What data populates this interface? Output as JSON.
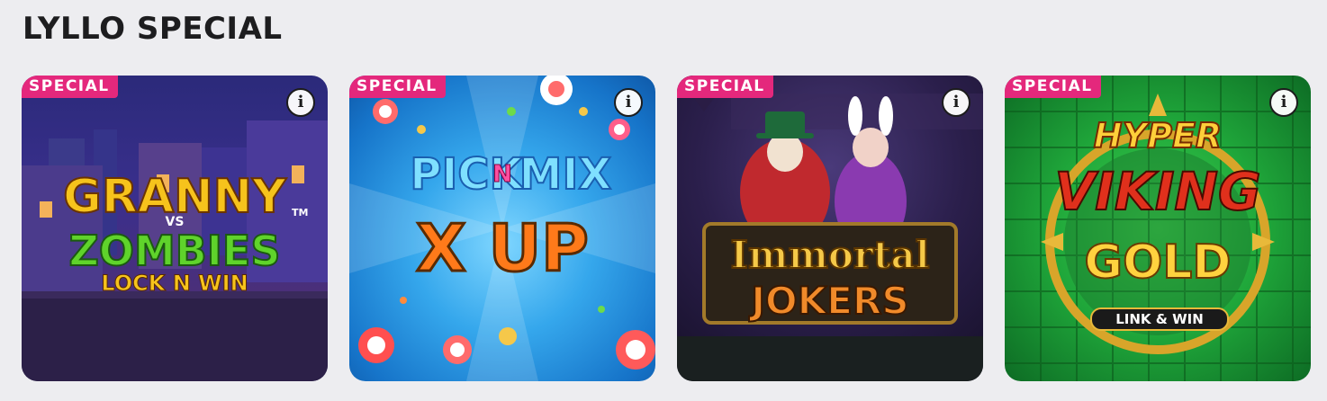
{
  "section": {
    "title": "LYLLO SPECIAL"
  },
  "games": [
    {
      "badge": "SPECIAL",
      "logo": {
        "line1": "GRANNY",
        "line2": "VS",
        "line3": "ZOMBIES",
        "line4": "LOCK N WIN",
        "trademark": "TM"
      }
    },
    {
      "badge": "SPECIAL",
      "logo": {
        "line1": "PICK",
        "line2": "N",
        "line3": "MIX",
        "line4": "X UP"
      }
    },
    {
      "badge": "SPECIAL",
      "logo": {
        "line1": "Immortal",
        "line2": "JOKERS"
      }
    },
    {
      "badge": "SPECIAL",
      "logo": {
        "line1": "HYPER",
        "line2": "VIKING",
        "line3": "GOLD",
        "line4": "LINK & WIN"
      }
    }
  ],
  "icons": {
    "info": "info-icon"
  },
  "colors": {
    "badge": "#e4287c",
    "page_bg": "#ededf0",
    "title": "#1d1d1f"
  }
}
